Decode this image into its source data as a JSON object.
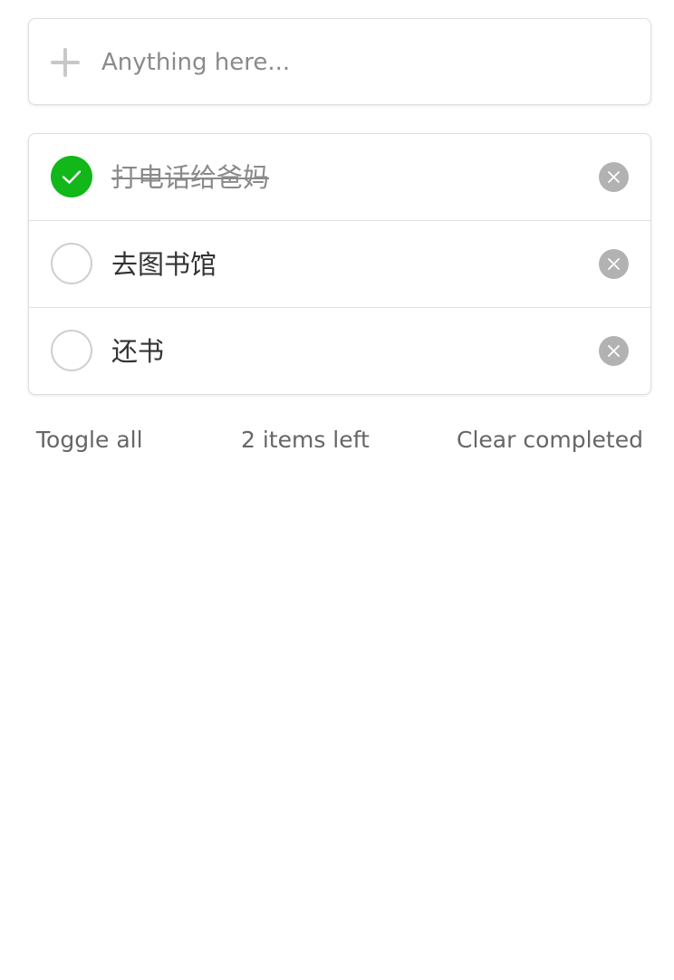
{
  "new_todo": {
    "placeholder": "Anything here...",
    "value": "",
    "icon": "plus-icon"
  },
  "todos": [
    {
      "title": "打电话给爸妈",
      "completed": true
    },
    {
      "title": "去图书馆",
      "completed": false
    },
    {
      "title": "还书",
      "completed": false
    }
  ],
  "footer": {
    "toggle_all_label": "Toggle all",
    "items_left_label": "2 items left",
    "clear_completed_label": "Clear completed"
  },
  "colors": {
    "completed_accent": "#12b719",
    "delete_button": "#b2b2b2",
    "muted_text": "#8a8a8a"
  }
}
